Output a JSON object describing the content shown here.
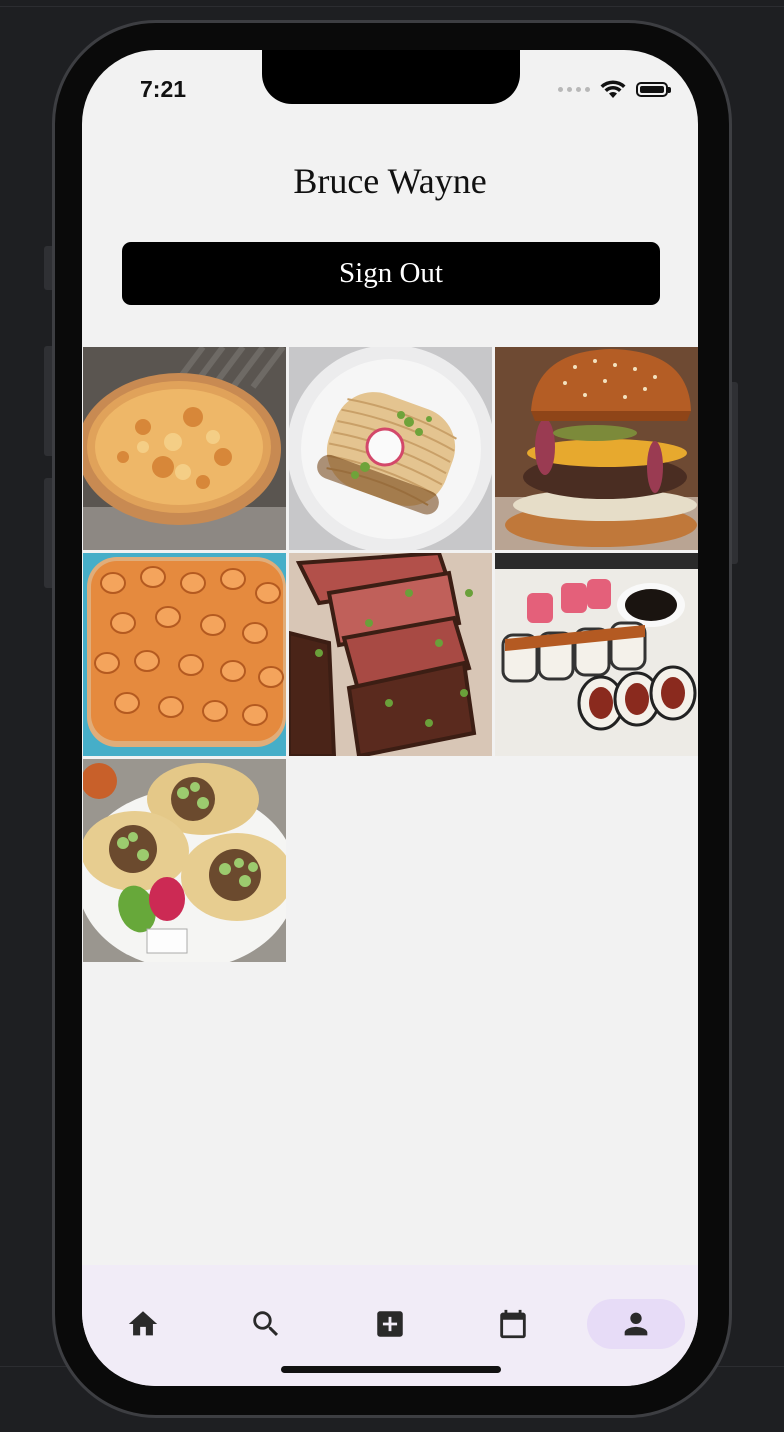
{
  "status_bar": {
    "time": "7:21"
  },
  "profile": {
    "name": "Bruce Wayne",
    "sign_out_label": "Sign Out"
  },
  "posts": [
    {
      "subject": "pizza"
    },
    {
      "subject": "noodles"
    },
    {
      "subject": "burger"
    },
    {
      "subject": "pasta"
    },
    {
      "subject": "steak"
    },
    {
      "subject": "sushi"
    },
    {
      "subject": "tacos"
    }
  ],
  "tabbar": {
    "items": [
      {
        "icon": "home-icon",
        "active": false
      },
      {
        "icon": "search-icon",
        "active": false
      },
      {
        "icon": "add-box-icon",
        "active": false
      },
      {
        "icon": "calendar-icon",
        "active": false
      },
      {
        "icon": "person-icon",
        "active": true
      }
    ],
    "icon_color": "#2a2a2a",
    "active_pill_color": "#e7dcf7",
    "background_color": "#f1ecf7"
  },
  "colors": {
    "screen_background": "#f2f2f2",
    "button_background": "#000000",
    "button_text": "#ffffff"
  }
}
